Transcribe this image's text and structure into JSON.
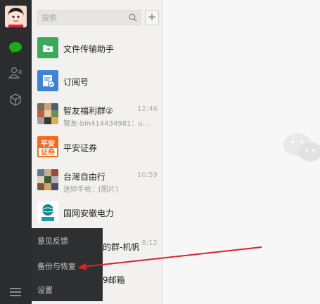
{
  "search": {
    "placeholder": "搜索"
  },
  "add_label": "+",
  "chats": [
    {
      "name": "文件传输助手",
      "sub": "",
      "time": ""
    },
    {
      "name": "订阅号",
      "sub": "",
      "time": ""
    },
    {
      "name": "智友福利群②",
      "sub": "智友-bin414434981：u...",
      "time": "12:46"
    },
    {
      "name": "平安证券",
      "sub": "",
      "time": ""
    },
    {
      "name": "台灣自由行",
      "sub": "迷妳手枪：[图片]",
      "time": "10:59"
    },
    {
      "name": "国网安徽电力",
      "sub": "",
      "time": ""
    },
    {
      "name": "的群-机帆",
      "sub": "",
      "time": "8:12"
    },
    {
      "name": "9邮箱",
      "sub": "",
      "time": ""
    }
  ],
  "popup_menu": [
    {
      "label": "意见反馈"
    },
    {
      "label": "备份与恢复"
    },
    {
      "label": "设置"
    }
  ],
  "logo_text": {
    "pingan": "平安\n证券"
  },
  "colors": {
    "rail": "#2b2c2e",
    "panel": "#f2f1f0",
    "accent_green": "#1aad19",
    "file_helper": "#3daa5b",
    "subscription": "#3f83d6",
    "pingan_orange": "#f26a1b",
    "arrow_red": "#d9232b"
  },
  "icons": [
    "chat-bubble-icon",
    "contacts-icon",
    "cube-icon",
    "search-icon",
    "menu-icon",
    "wechat-logo-icon",
    "red-arrow-icon"
  ]
}
